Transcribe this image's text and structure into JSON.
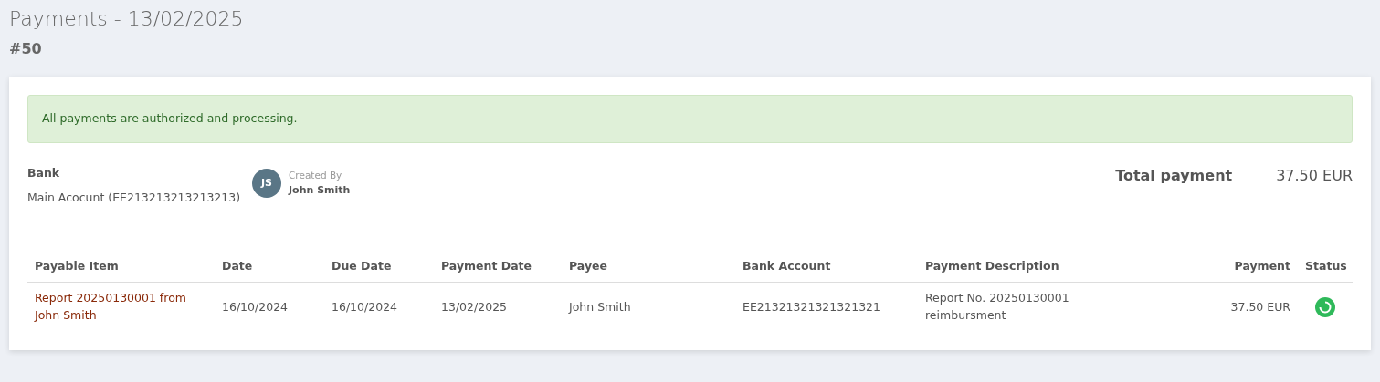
{
  "page": {
    "title": "Payments - 13/02/2025",
    "subtitle": "#50"
  },
  "alert": {
    "kind": "success",
    "text": "All payments are authorized and processing."
  },
  "summary": {
    "bank_label": "Bank",
    "bank_value": "Main Acocunt (EE213213213213213)",
    "avatar_initials": "JS",
    "created_by_label": "Created By",
    "created_by_name": "John Smith",
    "total_label": "Total payment",
    "total_value": "37.50 EUR"
  },
  "table": {
    "columns": [
      "Payable Item",
      "Date",
      "Due Date",
      "Payment Date",
      "Payee",
      "Bank Account",
      "Payment Description",
      "Payment",
      "Status"
    ],
    "rows": [
      {
        "payable_item": "Report 20250130001 from John Smith",
        "date": "16/10/2024",
        "due_date": "16/10/2024",
        "payment_date": "13/02/2025",
        "payee": "John Smith",
        "bank_account": "EE21321321321321321",
        "description": "Report No. 20250130001 reimbursment",
        "payment": "37.50 EUR",
        "processing": true
      }
    ]
  }
}
